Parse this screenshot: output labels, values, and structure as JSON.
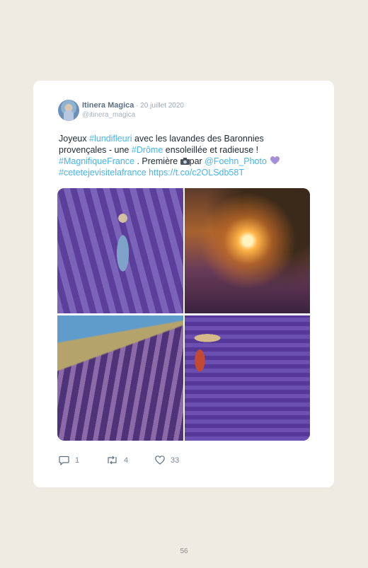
{
  "tweet": {
    "author_name": "Itinera Magica",
    "separator": " · ",
    "date": "20 juillet 2020",
    "handle": "@itinera_magica",
    "text": {
      "p1": "Joyeux ",
      "hashtag1": "#lundifleuri",
      "p2": " avec les lavandes des Baronnies provençales - une ",
      "hashtag2": "#Drôme",
      "p3": " ensoleillée et radieuse ! ",
      "hashtag3": "#MagnifiqueFrance",
      "p4": " . Première ",
      "p5": "par ",
      "mention": "@Foehn_Photo",
      "hashtag4": "#cetetejevisitelafrance",
      "space": " ",
      "link": "https://t.co/c2OLSdb58T"
    },
    "actions": {
      "replies": "1",
      "retweets": "4",
      "likes": "33"
    },
    "colors": {
      "link": "#47b4ec",
      "heart_emoji": "#a58fd9"
    }
  },
  "page": {
    "number": "56"
  }
}
